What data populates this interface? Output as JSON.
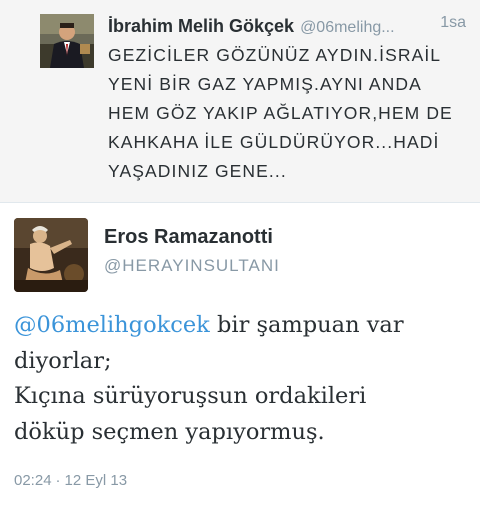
{
  "parent_tweet": {
    "name": "İbrahim Melih Gökçek",
    "handle": "@06melihg...",
    "time": "1sa",
    "text_lines": [
      "GEZİCİLER GÖZÜNÜZ AYDIN.İSRAİL",
      "YENİ BİR GAZ YAPMIŞ.AYNI ANDA",
      "HEM GÖZ YAKIP AĞLATIYOR,HEM DE",
      "KAHKAHA İLE GÜLDÜRÜYOR...HADİ",
      "YAŞADINIZ GENE..."
    ]
  },
  "main_tweet": {
    "name": "Eros Ramazanotti",
    "handle": "@HERAYINSULTANI",
    "mention": "@06melihgokcek",
    "text_after_mention": " bir şampuan var",
    "text_lines": [
      "diyorlar;",
      "Kıçına sürüyoruşsun ordakileri",
      "döküp seçmen yapıyormuş."
    ],
    "time": "02:24",
    "separator": "·",
    "date": "12 Eyl 13"
  },
  "colors": {
    "link": "#3b94d9",
    "muted": "#8899a6",
    "text": "#292f33",
    "parent_bg": "#f5f5f5"
  }
}
